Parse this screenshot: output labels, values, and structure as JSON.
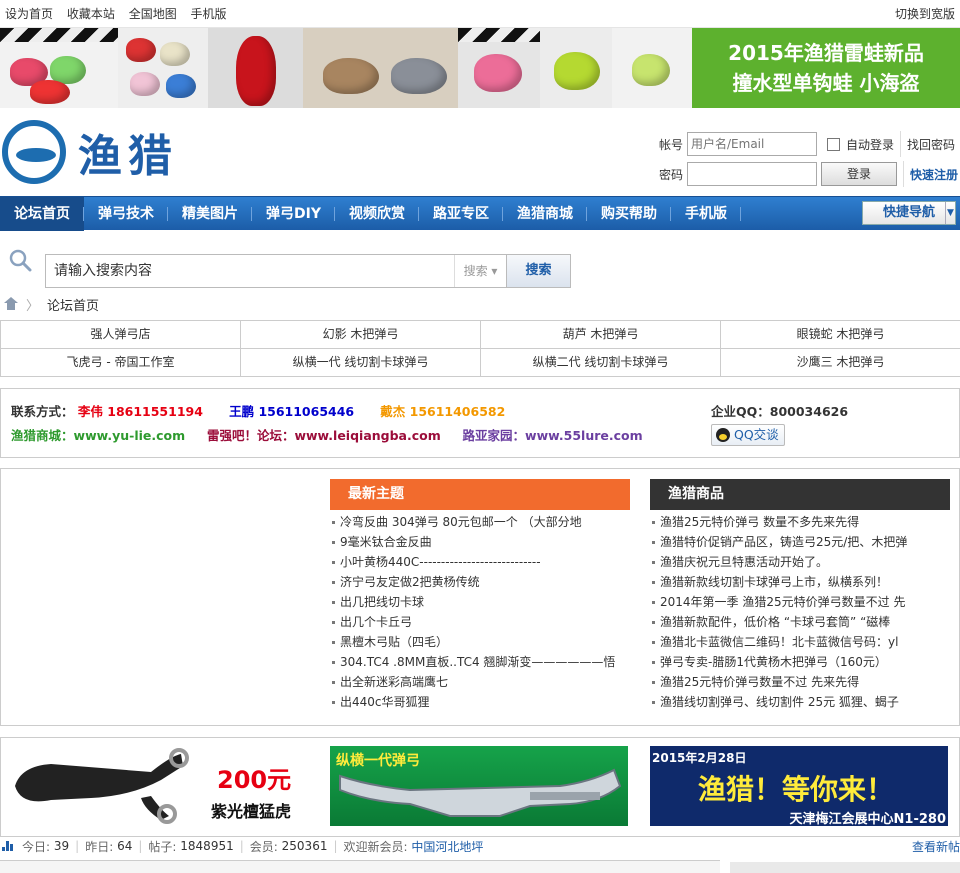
{
  "topbar": {
    "links": [
      "设为首页",
      "收藏本站",
      "全国地图",
      "手机版"
    ],
    "right": "切换到宽版"
  },
  "banner": {
    "promo_line1": "2015年渔猎雷蛙新品",
    "promo_line2": "撞水型单钩蛙 小海盗"
  },
  "logo": {
    "text": "渔猎"
  },
  "login": {
    "account_label": "帐号",
    "account_placeholder": "用户名/Email",
    "password_label": "密码",
    "remember": "自动登录",
    "login_button": "登录",
    "forgot": "找回密码",
    "register": "快速注册"
  },
  "nav": {
    "items": [
      "论坛首页",
      "弹弓技术",
      "精美图片",
      "弹弓DIY",
      "视频欣赏",
      "路亚专区",
      "渔猎商城",
      "购买帮助",
      "手机版"
    ],
    "quick": "快捷导航"
  },
  "search": {
    "placeholder": "请输入搜索内容",
    "scope": "搜索",
    "button": "搜索"
  },
  "breadcrumb": {
    "current": "论坛首页"
  },
  "friend_links": [
    "强人弹弓店",
    "幻影 木把弹弓",
    "葫芦 木把弹弓",
    "眼镜蛇 木把弹弓",
    "飞虎弓 - 帝国工作室",
    "纵横一代 线切割卡球弹弓",
    "纵横二代 线切割卡球弹弓",
    "沙鹰三 木把弹弓"
  ],
  "contact": {
    "label": "联系方式：",
    "p1_name": "李伟",
    "p1_phone": "18611551194",
    "p2_name": "王鹏",
    "p2_phone": "15611065446",
    "p3_name": "戴杰",
    "p3_phone": "15611406582",
    "shop_label": "渔猎商城：",
    "shop_url": "www.yu-lie.com",
    "forum_label": "雷强吧！论坛：",
    "forum_url": "www.leiqiangba.com",
    "lure_label": "路亚家园：",
    "lure_url": "www.55lure.com",
    "qq_label": "企业QQ：",
    "qq_number": "800034626",
    "qq_button": "QQ交谈",
    "colors": {
      "p1": "#e60012",
      "p2": "#0000cc",
      "p3": "#f39800",
      "shop": "#2e9a2e",
      "forum": "#9b0d3a",
      "lure": "#6b3fa0"
    }
  },
  "latest": {
    "title": "最新主题",
    "color": "#f26b2d",
    "items": [
      "冷弯反曲 304弹弓 80元包邮一个 （大部分地",
      "9毫米钛合金反曲",
      "小叶黄杨440C----------------------------",
      "济宁弓友定做2把黄杨传统",
      "出几把线切卡球",
      "出几个卡丘弓",
      "黑檀木弓贴（四毛）",
      "304.TC4 .8MM直板..TC4 翘脚渐变——————悟",
      "出全新迷彩高端鹰七",
      "出440c华哥狐狸"
    ]
  },
  "goods": {
    "title": "渔猎商品",
    "color": "#333333",
    "items": [
      "渔猎25元特价弹弓 数量不多先来先得",
      "渔猎特价促销产品区，铸造弓25元/把、木把弹",
      "渔猎庆祝元旦特惠活动开始了。",
      "渔猎新款线切割卡球弹弓上市，纵横系列！",
      "2014年第一季 渔猎25元特价弹弓数量不过 先",
      "渔猎新款配件，低价格 “卡球弓套筒” “磁棒",
      "渔猎北卡蓝微信二维码！北卡蓝微信号码：yl",
      "弹弓专卖-腊肠1代黄杨木把弹弓（160元）",
      "渔猎25元特价弹弓数量不过 先来先得",
      "渔猎线切割弹弓、线切割件 25元 狐狸、蝎子"
    ]
  },
  "ads": {
    "ad1_price": "200元",
    "ad1_name": "紫光檀猛虎",
    "ad2_title": "纵横一代弹弓",
    "ad3_date": "2015年2月28日",
    "ad3_main": "渔猎！等你来！",
    "ad3_place": "天津梅江会展中心N1-280"
  },
  "stats": {
    "today_label": "今日:",
    "today": "39",
    "yesterday_label": "昨日:",
    "yesterday": "64",
    "posts_label": "帖子:",
    "posts": "1848951",
    "members_label": "会员:",
    "members": "250361",
    "welcome_label": "欢迎新会员:",
    "new_member": "中国河北地坪",
    "more": "查看新帖"
  }
}
